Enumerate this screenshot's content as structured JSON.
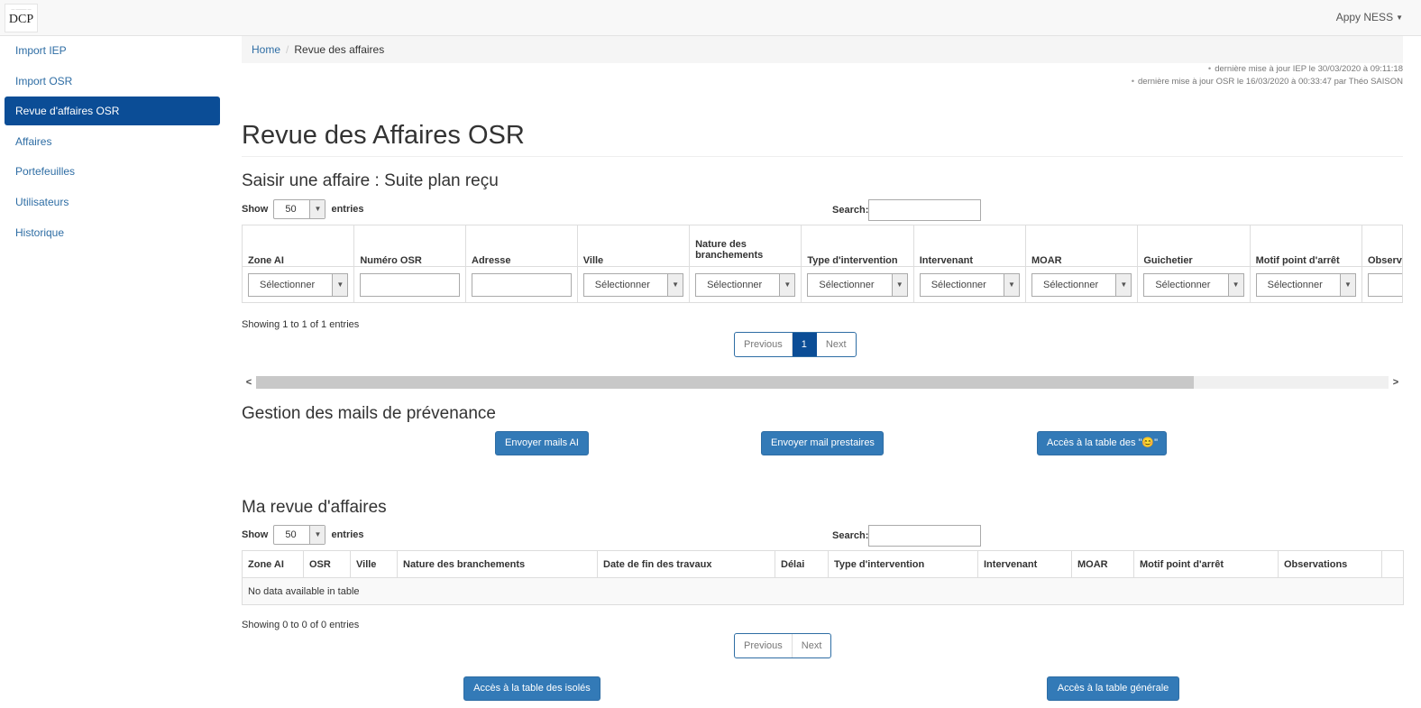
{
  "navbar": {
    "logo_small": "— ——— —",
    "logo_mark": "DCP",
    "user": "Appy NESS"
  },
  "sidebar": {
    "items": [
      {
        "label": "Import IEP"
      },
      {
        "label": "Import OSR"
      },
      {
        "label": "Revue d'affaires OSR",
        "active": true
      },
      {
        "label": "Affaires"
      },
      {
        "label": "Portefeuilles"
      },
      {
        "label": "Utilisateurs"
      },
      {
        "label": "Historique"
      }
    ]
  },
  "breadcrumb": {
    "home": "Home",
    "current": "Revue des affaires"
  },
  "updates": {
    "iep": "dernière mise à jour IEP le 30/03/2020 à 09:11:18",
    "osr": "dernière mise à jour OSR le 16/03/2020 à 00:33:47 par Théo SAISON"
  },
  "page_title": "Revue des Affaires OSR",
  "section1": {
    "title": "Saisir une affaire : Suite plan reçu",
    "show_label": "Show",
    "entries_value": "50",
    "entries_label": "entries",
    "search_label": "Search:",
    "columns": [
      "Zone AI",
      "Numéro OSR",
      "Adresse",
      "Ville",
      "Nature des branchements",
      "Type d'intervention",
      "Intervenant",
      "MOAR",
      "Guichetier",
      "Motif point d'arrêt",
      "Observ"
    ],
    "select_placeholder": "Sélectionner",
    "info": "Showing 1 to 1 of 1 entries",
    "pager": {
      "previous": "Previous",
      "page": "1",
      "next": "Next"
    }
  },
  "section2": {
    "title": "Gestion des mails de prévenance",
    "btn_ai": "Envoyer mails AI",
    "btn_prestataires": "Envoyer mail prestaires",
    "btn_table": "Accès à la table des \"😊\""
  },
  "section3": {
    "title": "Ma revue d'affaires",
    "show_label": "Show",
    "entries_value": "50",
    "entries_label": "entries",
    "search_label": "Search:",
    "columns": [
      "Zone AI",
      "OSR",
      "Ville",
      "Nature des branchements",
      "Date de fin des travaux",
      "Délai",
      "Type d'intervention",
      "Intervenant",
      "MOAR",
      "Motif point d'arrêt",
      "Observations"
    ],
    "empty": "No data available in table",
    "info": "Showing 0 to 0 of 0 entries",
    "pager": {
      "previous": "Previous",
      "next": "Next"
    },
    "btn_isoles": "Accès à la table des isolés",
    "btn_generale": "Accès à la table générale"
  },
  "icons": {
    "dropdown": "caret-down-icon",
    "scroll_left": "chevron-left-icon",
    "scroll_right": "chevron-right-icon"
  }
}
